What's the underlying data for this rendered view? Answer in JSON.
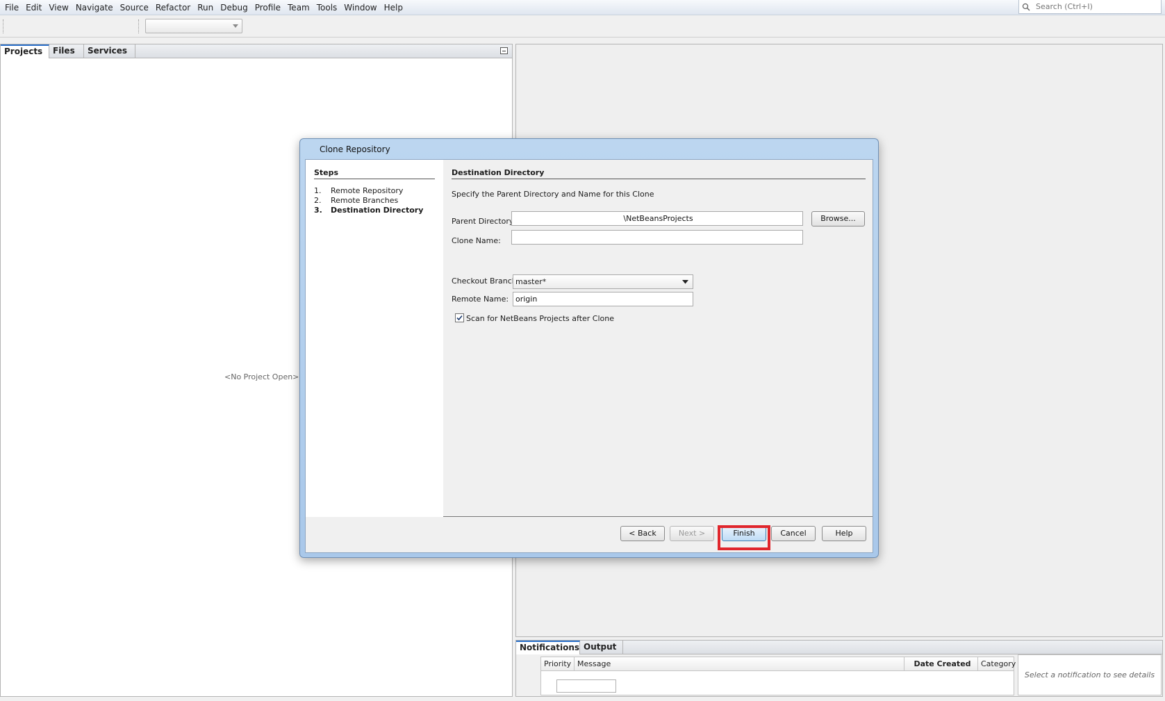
{
  "menubar": {
    "items": [
      "File",
      "Edit",
      "View",
      "Navigate",
      "Source",
      "Refactor",
      "Run",
      "Debug",
      "Profile",
      "Team",
      "Tools",
      "Window",
      "Help"
    ],
    "search_placeholder": "Search (Ctrl+I)"
  },
  "left_panel": {
    "tabs": [
      "Projects",
      "Files",
      "Services"
    ],
    "empty_message": "<No Project Open>"
  },
  "bottom_panel": {
    "tabs": [
      "Notifications",
      "Output"
    ],
    "columns": [
      "Priority",
      "Message",
      "Date Created",
      "Category"
    ],
    "details_placeholder": "Select a notification to see details"
  },
  "dialog": {
    "title": "Clone Repository",
    "steps_title": "Steps",
    "steps": [
      {
        "num": "1.",
        "label": "Remote Repository"
      },
      {
        "num": "2.",
        "label": "Remote Branches"
      },
      {
        "num": "3.",
        "label": "Destination Directory"
      }
    ],
    "section_title": "Destination Directory",
    "description": "Specify the Parent Directory and Name for this Clone",
    "parent_dir_label": "Parent Directory:",
    "parent_dir_value": "\\NetBeansProjects",
    "browse_label": "Browse...",
    "clone_name_label": "Clone Name:",
    "clone_name_value": "",
    "checkout_branch_label": "Checkout Branch:",
    "checkout_branch_value": "master*",
    "remote_name_label": "Remote Name:",
    "remote_name_value": "origin",
    "scan_label": "Scan for NetBeans Projects after Clone",
    "scan_checked": true,
    "buttons": {
      "back": "< Back",
      "next": "Next >",
      "finish": "Finish",
      "cancel": "Cancel",
      "help": "Help"
    }
  },
  "colors": {
    "highlight": "#e0262c",
    "dialog_title_bar": "#bcd6f0",
    "default_button": "#bfdcf6"
  }
}
